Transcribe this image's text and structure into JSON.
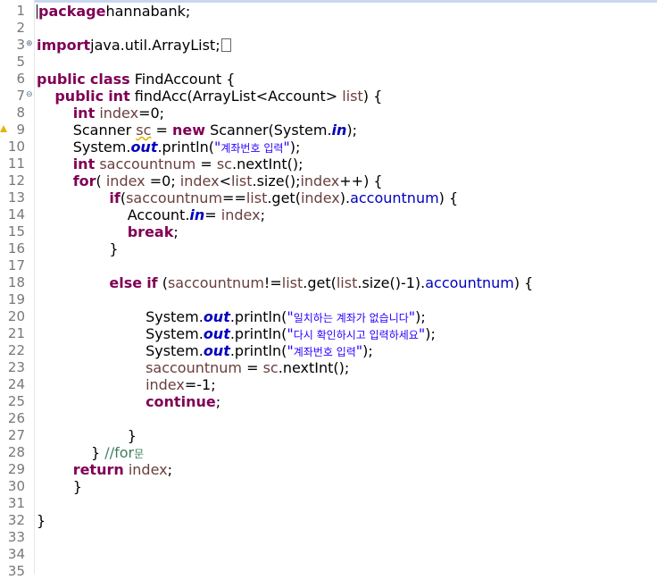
{
  "editor": {
    "lines": [
      {
        "n": "1",
        "marker": "",
        "segs": [
          [
            "kw",
            "package"
          ],
          [
            "",
            "hannabank;"
          ]
        ]
      },
      {
        "n": "2",
        "marker": "",
        "segs": []
      },
      {
        "n": "3",
        "marker": "fold-plus",
        "segs": [
          [
            "kw",
            "import"
          ],
          [
            "",
            "java.util.ArrayList;"
          ]
        ],
        "folded": true
      },
      {
        "n": "5",
        "marker": "",
        "segs": []
      },
      {
        "n": "6",
        "marker": "",
        "segs": [
          [
            "kw",
            "public"
          ],
          [
            "",
            " "
          ],
          [
            "kw",
            "class"
          ],
          [
            "",
            " FindAccount {"
          ]
        ]
      },
      {
        "n": "7",
        "marker": "fold-minus",
        "segs": [
          [
            "",
            "    "
          ],
          [
            "kw",
            "public"
          ],
          [
            "",
            " "
          ],
          [
            "kw",
            "int"
          ],
          [
            "",
            " findAcc(ArrayList<Account> "
          ],
          [
            "var",
            "list"
          ],
          [
            "",
            ") {"
          ]
        ]
      },
      {
        "n": "8",
        "marker": "",
        "segs": [
          [
            "",
            "        "
          ],
          [
            "kw",
            "int"
          ],
          [
            "",
            " "
          ],
          [
            "var",
            "index"
          ],
          [
            "",
            "=0;"
          ]
        ]
      },
      {
        "n": "9",
        "marker": "warning",
        "segs": [
          [
            "",
            "        Scanner "
          ],
          [
            "var warnul",
            "sc"
          ],
          [
            "",
            " = "
          ],
          [
            "kw",
            "new"
          ],
          [
            "",
            " Scanner(System."
          ],
          [
            "sfld",
            "in"
          ],
          [
            "",
            ");"
          ]
        ]
      },
      {
        "n": "10",
        "marker": "",
        "segs": [
          [
            "",
            "        System."
          ],
          [
            "sfld",
            "out"
          ],
          [
            "",
            ".println("
          ],
          [
            "str",
            "\""
          ],
          [
            "str ko",
            "계좌번호 입력"
          ],
          [
            "str",
            "\""
          ],
          [
            "",
            ");"
          ]
        ]
      },
      {
        "n": "11",
        "marker": "",
        "segs": [
          [
            "",
            "        "
          ],
          [
            "kw",
            "int"
          ],
          [
            "",
            " "
          ],
          [
            "var",
            "saccountnum"
          ],
          [
            "",
            " = "
          ],
          [
            "var",
            "sc"
          ],
          [
            "",
            ".nextInt();"
          ]
        ]
      },
      {
        "n": "12",
        "marker": "",
        "segs": [
          [
            "",
            "        "
          ],
          [
            "kw",
            "for"
          ],
          [
            "",
            "( "
          ],
          [
            "var",
            "index"
          ],
          [
            "",
            " =0; "
          ],
          [
            "var",
            "index"
          ],
          [
            "",
            "<"
          ],
          [
            "var",
            "list"
          ],
          [
            "",
            ".size();"
          ],
          [
            "var",
            "index"
          ],
          [
            "",
            "++) {"
          ]
        ]
      },
      {
        "n": "13",
        "marker": "",
        "segs": [
          [
            "",
            "                "
          ],
          [
            "kw",
            "if"
          ],
          [
            "",
            "("
          ],
          [
            "var",
            "saccountnum"
          ],
          [
            "",
            "=="
          ],
          [
            "var",
            "list"
          ],
          [
            "",
            ".get("
          ],
          [
            "var",
            "index"
          ],
          [
            "",
            ")."
          ],
          [
            "fld",
            "accountnum"
          ],
          [
            "",
            ") {"
          ]
        ]
      },
      {
        "n": "14",
        "marker": "",
        "segs": [
          [
            "",
            "                    Account."
          ],
          [
            "sfld",
            "in"
          ],
          [
            "",
            "= "
          ],
          [
            "var",
            "index"
          ],
          [
            "",
            ";"
          ]
        ]
      },
      {
        "n": "15",
        "marker": "",
        "segs": [
          [
            "",
            "                    "
          ],
          [
            "kw",
            "break"
          ],
          [
            "",
            ";"
          ]
        ]
      },
      {
        "n": "16",
        "marker": "",
        "segs": [
          [
            "",
            "                }"
          ]
        ]
      },
      {
        "n": "17",
        "marker": "",
        "segs": []
      },
      {
        "n": "18",
        "marker": "",
        "segs": [
          [
            "",
            "                "
          ],
          [
            "kw",
            "else"
          ],
          [
            "",
            " "
          ],
          [
            "kw",
            "if"
          ],
          [
            "",
            " ("
          ],
          [
            "var",
            "saccountnum"
          ],
          [
            "",
            "!="
          ],
          [
            "var",
            "list"
          ],
          [
            "",
            ".get("
          ],
          [
            "var",
            "list"
          ],
          [
            "",
            ".size()-1)."
          ],
          [
            "fld",
            "accountnum"
          ],
          [
            "",
            ") {"
          ]
        ]
      },
      {
        "n": "19",
        "marker": "",
        "segs": []
      },
      {
        "n": "20",
        "marker": "",
        "segs": [
          [
            "",
            "                        System."
          ],
          [
            "sfld",
            "out"
          ],
          [
            "",
            ".println("
          ],
          [
            "str",
            "\""
          ],
          [
            "str ko",
            "일치하는 계좌가 없습니다"
          ],
          [
            "str",
            "\""
          ],
          [
            "",
            ");"
          ]
        ]
      },
      {
        "n": "21",
        "marker": "",
        "segs": [
          [
            "",
            "                        System."
          ],
          [
            "sfld",
            "out"
          ],
          [
            "",
            ".println("
          ],
          [
            "str",
            "\""
          ],
          [
            "str ko",
            "다시 확인하시고 입력하세요"
          ],
          [
            "str",
            "\""
          ],
          [
            "",
            ");"
          ]
        ]
      },
      {
        "n": "22",
        "marker": "",
        "segs": [
          [
            "",
            "                        System."
          ],
          [
            "sfld",
            "out"
          ],
          [
            "",
            ".println("
          ],
          [
            "str",
            "\""
          ],
          [
            "str ko",
            "계좌번호 입력"
          ],
          [
            "str",
            "\""
          ],
          [
            "",
            ");"
          ]
        ]
      },
      {
        "n": "23",
        "marker": "",
        "segs": [
          [
            "",
            "                        "
          ],
          [
            "var",
            "saccountnum"
          ],
          [
            "",
            " = "
          ],
          [
            "var",
            "sc"
          ],
          [
            "",
            ".nextInt();"
          ]
        ]
      },
      {
        "n": "24",
        "marker": "",
        "segs": [
          [
            "",
            "                        "
          ],
          [
            "var",
            "index"
          ],
          [
            "",
            "=-1;"
          ]
        ]
      },
      {
        "n": "25",
        "marker": "",
        "segs": [
          [
            "",
            "                        "
          ],
          [
            "kw",
            "continue"
          ],
          [
            "",
            ";"
          ]
        ]
      },
      {
        "n": "26",
        "marker": "",
        "segs": []
      },
      {
        "n": "27",
        "marker": "",
        "segs": [
          [
            "",
            "                    }"
          ]
        ]
      },
      {
        "n": "28",
        "marker": "",
        "segs": [
          [
            "",
            "            } "
          ],
          [
            "cmt",
            "//for"
          ],
          [
            "cmt ko",
            "문"
          ]
        ]
      },
      {
        "n": "29",
        "marker": "",
        "segs": [
          [
            "",
            "        "
          ],
          [
            "kw",
            "return"
          ],
          [
            "",
            " "
          ],
          [
            "var",
            "index"
          ],
          [
            "",
            ";"
          ]
        ]
      },
      {
        "n": "30",
        "marker": "",
        "segs": [
          [
            "",
            "        }"
          ]
        ]
      },
      {
        "n": "31",
        "marker": "",
        "segs": []
      },
      {
        "n": "32",
        "marker": "",
        "segs": [
          [
            "",
            "}"
          ]
        ]
      },
      {
        "n": "33",
        "marker": "",
        "segs": []
      },
      {
        "n": "34",
        "marker": "",
        "segs": []
      },
      {
        "n": "35",
        "marker": "",
        "segs": []
      }
    ]
  }
}
